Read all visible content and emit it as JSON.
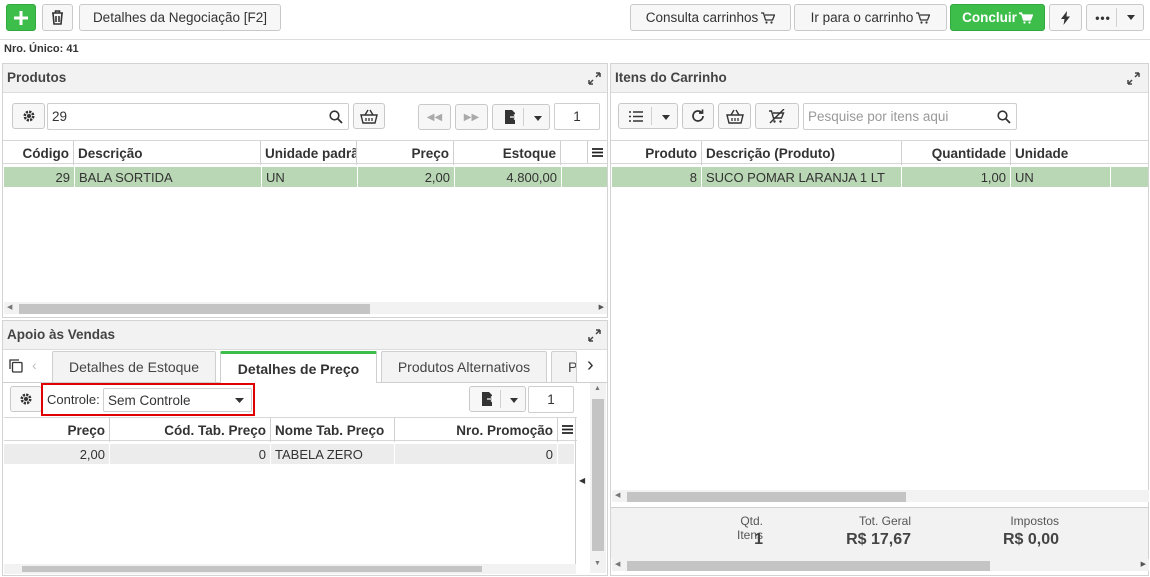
{
  "toolbar": {
    "details_label": "Detalhes da Negociação [F2]",
    "consulta_label": "Consulta carrinhos",
    "ir_label": "Ir para o carrinho",
    "concluir_label": "Concluir"
  },
  "nro_unico": "Nro. Único: 41",
  "produtos": {
    "title": "Produtos",
    "search_value": "29",
    "page": "1",
    "columns": [
      "Código",
      "Descrição",
      "Unidade padrã",
      "Preço",
      "Estoque"
    ],
    "rows": [
      {
        "codigo": "29",
        "descricao": "BALA SORTIDA",
        "unidade": "UN",
        "preco": "2,00",
        "estoque": "4.800,00"
      }
    ]
  },
  "carrinho": {
    "title": "Itens do Carrinho",
    "search_placeholder": "Pesquise por itens aqui",
    "columns": [
      "Produto",
      "Descrição (Produto)",
      "Quantidade",
      "Unidade"
    ],
    "rows": [
      {
        "produto": "8",
        "descricao": "SUCO POMAR LARANJA 1 LT",
        "quantidade": "1,00",
        "unidade": "UN"
      }
    ],
    "footer": {
      "qtd_label": "Qtd. Itens",
      "qtd_value": "1",
      "total_label": "Tot. Geral",
      "total_value": "R$ 17,67",
      "impostos_label": "Impostos",
      "impostos_value": "R$ 0,00"
    }
  },
  "apoio": {
    "title": "Apoio às Vendas",
    "tabs": [
      "Detalhes de Estoque",
      "Detalhes de Preço",
      "Produtos Alternativos",
      "P"
    ],
    "active_tab": "Detalhes de Preço",
    "controle_label": "Controle:",
    "controle_value": "Sem Controle",
    "page": "1",
    "columns": [
      "Preço",
      "Cód. Tab. Preço",
      "Nome Tab. Preço",
      "Nro. Promoção"
    ],
    "rows": [
      {
        "preco": "2,00",
        "cod_tab": "0",
        "nome_tab": "TABELA ZERO",
        "nro_promocao": "0"
      }
    ]
  },
  "colors": {
    "accent_green": "#3dbd4a",
    "selected_row": "#b9d7b4",
    "highlight_red": "#e00000"
  }
}
